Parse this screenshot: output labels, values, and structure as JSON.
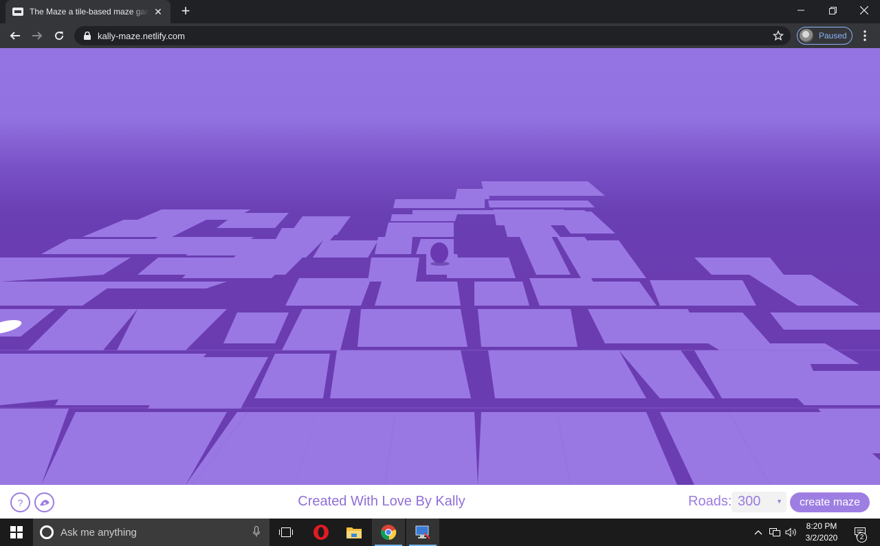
{
  "browser": {
    "tab_title": "The Maze a tile-based maze game",
    "url": "kally-maze.netlify.com",
    "profile_status": "Paused"
  },
  "game": {
    "credit": "Created With Love By Kally",
    "roads_label": "Roads:",
    "roads_value": "300",
    "create_button": "create maze",
    "help_button": "?"
  },
  "taskbar": {
    "search_placeholder": "Ask me anything",
    "time": "8:20 PM",
    "date": "3/2/2020",
    "notification_count": "2"
  },
  "colors": {
    "sky_top": "#9374e2",
    "floor": "#6b3db2",
    "tile": "#9a78e4",
    "accent": "#9e7ee2"
  }
}
